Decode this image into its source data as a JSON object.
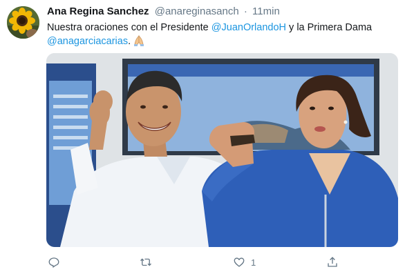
{
  "tweet": {
    "author": {
      "display_name": "Ana Regina Sanchez",
      "handle": "@anareginasanch",
      "avatar_icon": "sunflower-avatar"
    },
    "separator": "·",
    "time": "11min",
    "text": {
      "part1": "Nuestra oraciones con el Presidente ",
      "mention1": "@JuanOrlandoH",
      "part2": " y la Primera Dama ",
      "mention2": "@anagarciacarias",
      "part3": ".",
      "emoji_icon": "folded-hands-icon"
    },
    "photo": {
      "subject": "photo-two-people-raising-fists"
    },
    "actions": {
      "reply_icon": "reply-icon",
      "retweet_icon": "retweet-icon",
      "like_icon": "heart-icon",
      "like_count": "1",
      "share_icon": "share-icon"
    },
    "colors": {
      "link": "#1b95e0",
      "secondary_text": "#657786",
      "primary_text": "#14171a"
    }
  }
}
